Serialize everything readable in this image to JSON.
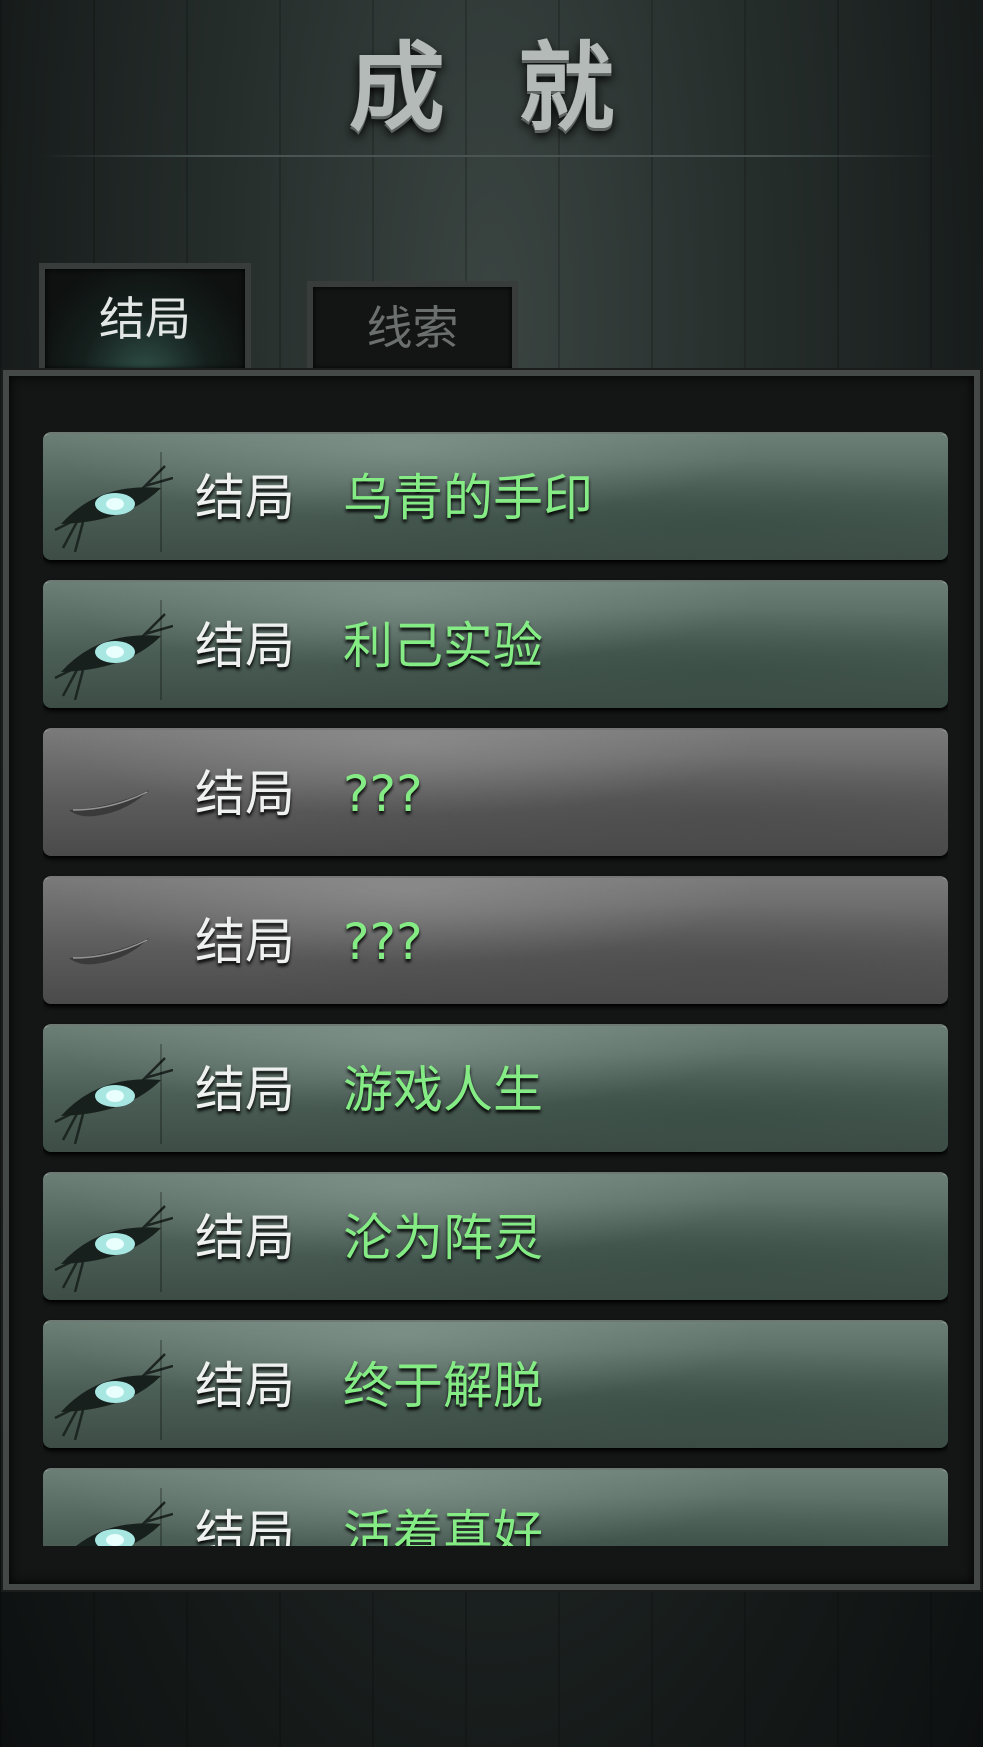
{
  "header": {
    "title": "成 就"
  },
  "tabs": [
    {
      "label": "结局",
      "active": true
    },
    {
      "label": "线索",
      "active": false
    }
  ],
  "endings": [
    {
      "label": "结局",
      "title": "乌青的手印",
      "unlocked": true,
      "icon": "open-eye-icon"
    },
    {
      "label": "结局",
      "title": "利己实验",
      "unlocked": true,
      "icon": "open-eye-icon"
    },
    {
      "label": "结局",
      "title": "???",
      "unlocked": false,
      "icon": "closed-eye-icon"
    },
    {
      "label": "结局",
      "title": "???",
      "unlocked": false,
      "icon": "closed-eye-icon"
    },
    {
      "label": "结局",
      "title": "游戏人生",
      "unlocked": true,
      "icon": "open-eye-icon"
    },
    {
      "label": "结局",
      "title": "沦为阵灵",
      "unlocked": true,
      "icon": "open-eye-icon"
    },
    {
      "label": "结局",
      "title": "终于解脱",
      "unlocked": true,
      "icon": "open-eye-icon"
    },
    {
      "label": "结局",
      "title": "活着真好",
      "unlocked": true,
      "icon": "open-eye-icon"
    }
  ],
  "colors": {
    "title_text": "#b4bab7",
    "ending_title": "#85ec85",
    "unlocked_card": "#56695f",
    "locked_card": "#5e5e5e"
  }
}
